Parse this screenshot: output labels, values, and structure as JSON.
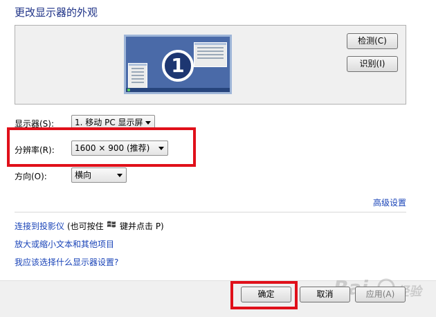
{
  "page": {
    "title": "更改显示器的外观"
  },
  "preview": {
    "monitor_number": "1",
    "detect_button": "检测(C)",
    "identify_button": "识别(I)"
  },
  "form": {
    "display_label": "显示器(S):",
    "display_value": "1. 移动 PC 显示屏",
    "resolution_label": "分辨率(R):",
    "resolution_value": "1600 × 900 (推荐)",
    "orientation_label": "方向(O):",
    "orientation_value": "横向"
  },
  "links": {
    "advanced": "高级设置",
    "projector": "连接到投影仪",
    "projector_hint_prefix": "(也可按住",
    "projector_hint_suffix": "键并点击 P)",
    "text_size": "放大或缩小文本和其他项目",
    "which_settings": "我应该选择什么显示器设置?"
  },
  "buttons": {
    "ok": "确定",
    "cancel": "取消",
    "apply": "应用(A)"
  },
  "highlight_color": "#e0101a",
  "link_color": "#1a44b8",
  "watermark": "Baidu经验"
}
